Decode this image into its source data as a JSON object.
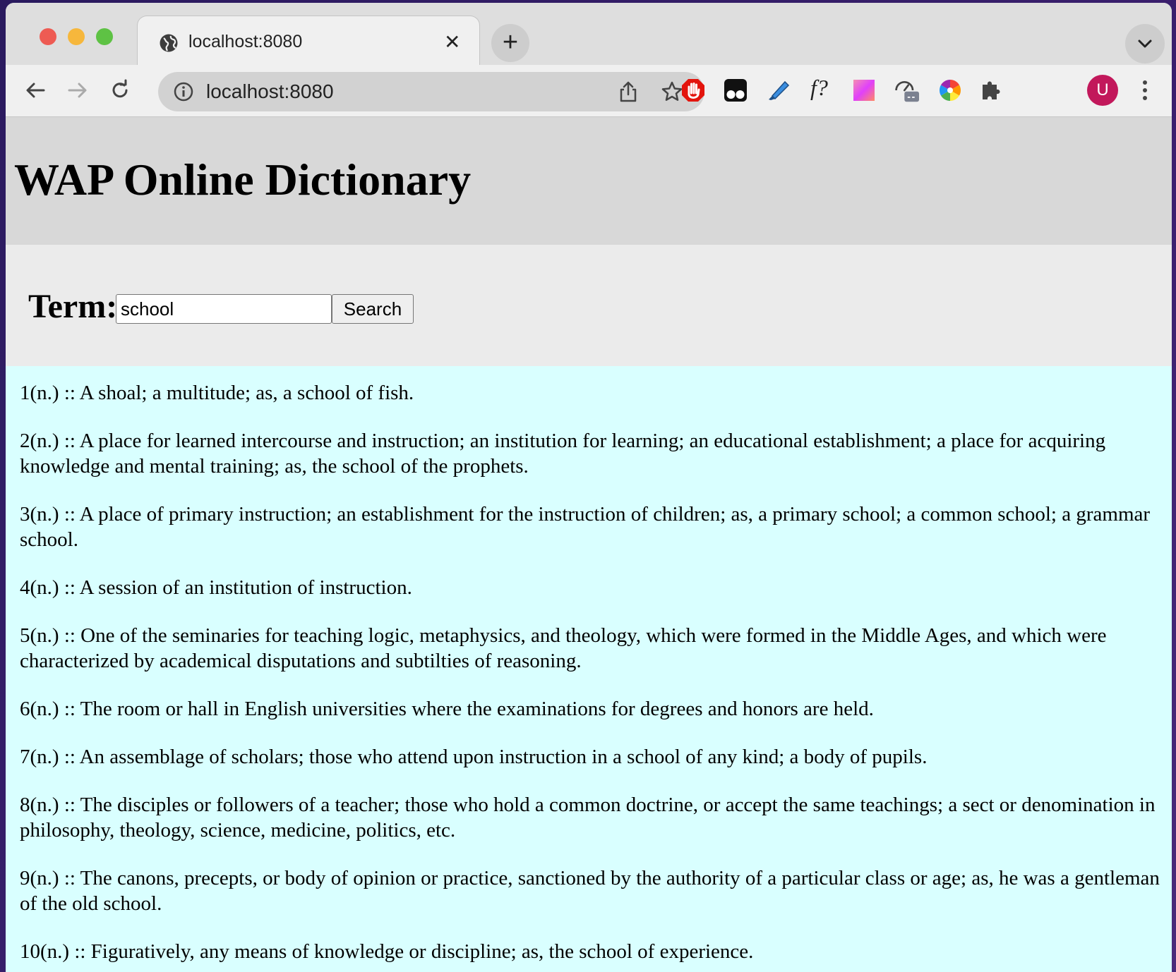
{
  "browser": {
    "tab_title": "localhost:8080",
    "tab_close": "✕",
    "new_tab": "+",
    "url": "localhost:8080",
    "avatar_letter": "U",
    "extensions": [
      "adblock-icon",
      "tampermonkey-icon",
      "highlighter-icon",
      "font-identifier-icon",
      "color-gradient-icon",
      "speed-meter-icon",
      "color-wheel-icon",
      "extensions-puzzle-icon"
    ],
    "extension_labels": {
      "font_identifier": "f?"
    }
  },
  "page": {
    "heading": "WAP Online Dictionary",
    "search": {
      "label": "Term:",
      "value": "school",
      "button": "Search"
    },
    "definitions": [
      "1(n.) :: A shoal; a multitude; as, a school of fish.",
      "2(n.) :: A place for learned intercourse and instruction; an institution for learning; an educational establishment; a place for acquiring knowledge and mental training; as, the school of the prophets.",
      "3(n.) :: A place of primary instruction; an establishment for the instruction of children; as, a primary school; a common school; a grammar school.",
      "4(n.) :: A session of an institution of instruction.",
      "5(n.) :: One of the seminaries for teaching logic, metaphysics, and theology, which were formed in the Middle Ages, and which were characterized by academical disputations and subtilties of reasoning.",
      "6(n.) :: The room or hall in English universities where the examinations for degrees and honors are held.",
      "7(n.) :: An assemblage of scholars; those who attend upon instruction in a school of any kind; a body of pupils.",
      "8(n.) :: The disciples or followers of a teacher; those who hold a common doctrine, or accept the same teachings; a sect or denomination in philosophy, theology, science, medicine, politics, etc.",
      "9(n.) :: The canons, precepts, or body of opinion or practice, sanctioned by the authority of a particular class or age; as, he was a gentleman of the old school.",
      "10(n.) :: Figuratively, any means of knowledge or discipline; as, the school of experience."
    ]
  },
  "colors": {
    "header_bg": "#d8d8d8",
    "search_bg": "#ebebeb",
    "results_bg": "#d9ffff",
    "avatar": "#c2185b"
  }
}
